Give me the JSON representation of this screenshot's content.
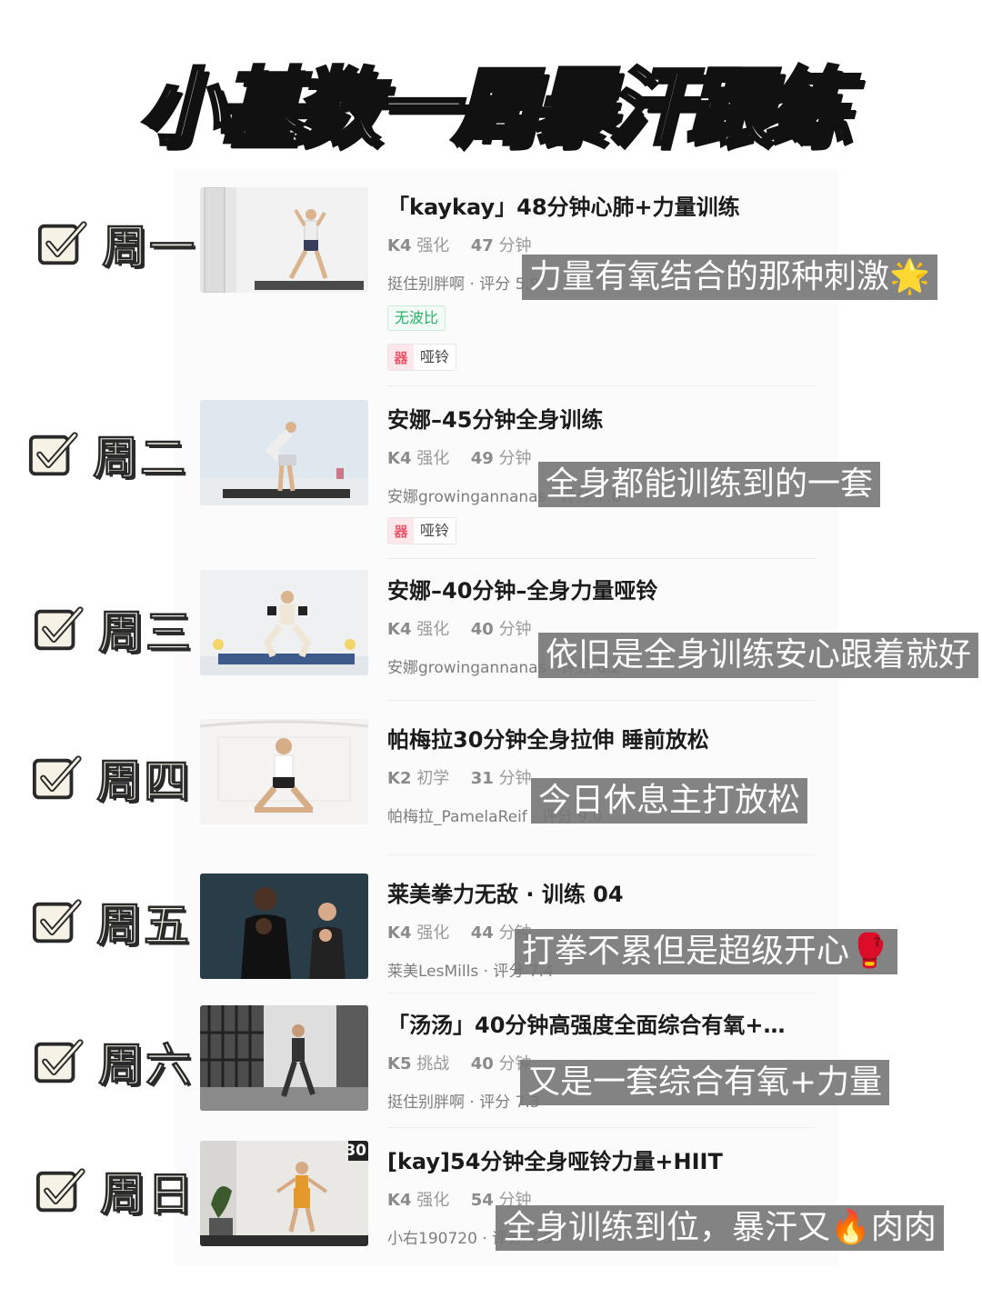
{
  "title": "小基数一周暴汗跟练",
  "days": [
    {
      "day": "周一",
      "course_title": "「kaykay」48分钟心肺+力量训练",
      "level": "K4",
      "difficulty": "强化",
      "duration": "47",
      "duration_unit": "分钟",
      "author": "挺住别胖啊 · 评分 5.9",
      "tag": "无波比",
      "equipment_icon": "器",
      "equipment": "哑铃",
      "note": "力量有氧结合的那种刺激🌟"
    },
    {
      "day": "周二",
      "course_title": "安娜–45分钟全身训练",
      "level": "K4",
      "difficulty": "强化",
      "duration": "49",
      "duration_unit": "分钟",
      "author": "安娜growingannanas · 评分 7.6",
      "equipment_icon": "器",
      "equipment": "哑铃",
      "note": "全身都能训练到的一套"
    },
    {
      "day": "周三",
      "course_title": "安娜–40分钟–全身力量哑铃",
      "level": "K4",
      "difficulty": "强化",
      "duration": "40",
      "duration_unit": "分钟",
      "author": "安娜growingannanas · 评分 6.2",
      "note": "依旧是全身训练安心跟着就好"
    },
    {
      "day": "周四",
      "course_title": "帕梅拉30分钟全身拉伸 睡前放松",
      "level": "K2",
      "difficulty": "初学",
      "duration": "31",
      "duration_unit": "分钟",
      "author": "帕梅拉_PamelaReif · 评分 9.0",
      "note": "今日休息主打放松"
    },
    {
      "day": "周五",
      "course_title": "莱美拳力无敌 · 训练 04",
      "level": "K4",
      "difficulty": "强化",
      "duration": "44",
      "duration_unit": "分钟",
      "author": "莱美LesMills · 评分 7.4",
      "note": "打拳不累但是超级开心🥊"
    },
    {
      "day": "周六",
      "course_title": "「汤汤」40分钟高强度全面综合有氧+…",
      "level": "K5",
      "difficulty": "挑战",
      "duration": "40",
      "duration_unit": "分钟",
      "author": "挺住别胖啊 · 评分 7.3",
      "note": "又是一套综合有氧+力量"
    },
    {
      "day": "周日",
      "course_title": "[kay]54分钟全身哑铃力量+HIIT",
      "level": "K4",
      "difficulty": "强化",
      "duration": "54",
      "duration_unit": "分钟",
      "author": "小右190720 · 评分 7.5",
      "thumb_badge": "30",
      "note": "全身训练到位，暴汗又🔥肉肉"
    }
  ]
}
